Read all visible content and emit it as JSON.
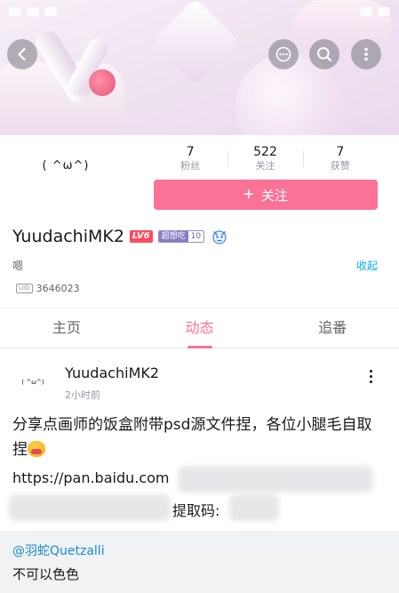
{
  "header": {
    "icons": {
      "back": "chevron-left-icon",
      "more": "more-horizontal-icon",
      "search": "search-icon",
      "menu": "more-vertical-icon"
    }
  },
  "profile": {
    "avatar_text": "( ^ω^)",
    "stats": [
      {
        "value": "7",
        "label": "粉丝"
      },
      {
        "value": "522",
        "label": "关注"
      },
      {
        "value": "7",
        "label": "获赞"
      }
    ],
    "follow_plus": "+",
    "follow_label": "关注",
    "username": "YuudachiMK2",
    "level_badge": "LV6",
    "medal_name": "超想吃",
    "medal_level": "10",
    "signature": "嗯",
    "collapse_label": "收起",
    "uid_tag": "UID",
    "uid": "3646023"
  },
  "tabs": [
    {
      "label": "主页",
      "active": false
    },
    {
      "label": "动态",
      "active": true
    },
    {
      "label": "追番",
      "active": false
    }
  ],
  "post": {
    "avatar_text": "( ^ω^)",
    "author": "YuudachiMK2",
    "time": "2小时前",
    "text": "分享点画师的饭盒附带psd源文件捏，各位小腿毛自取捏",
    "link_prefix": "https://pan.baidu.com",
    "code_label": "提取码:"
  },
  "comment": {
    "user": "@羽蛇Quetzalli",
    "text": "不可以色色"
  },
  "colors": {
    "accent": "#fb7299",
    "link": "#00aeec",
    "mention": "#178bcf",
    "level": "#ff4b5e",
    "medal": "#8a7cc2"
  }
}
